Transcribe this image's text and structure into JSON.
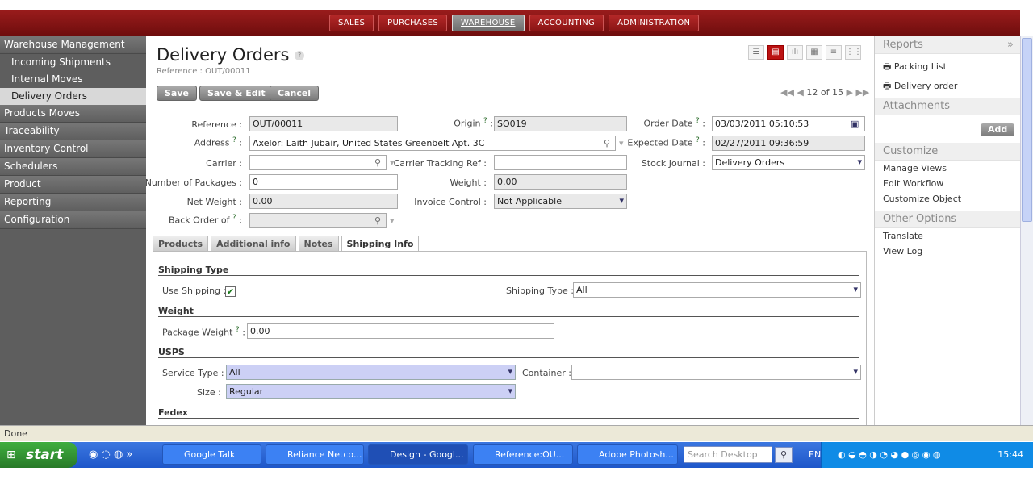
{
  "top_menu": [
    "SALES",
    "PURCHASES",
    "WAREHOUSE",
    "ACCOUNTING",
    "ADMINISTRATION"
  ],
  "sidebar": {
    "sections": [
      {
        "label": "Warehouse Management",
        "items": [
          "Incoming Shipments",
          "Internal Moves",
          "Delivery Orders"
        ]
      },
      {
        "label": "Products Moves",
        "items": []
      },
      {
        "label": "Traceability",
        "items": []
      },
      {
        "label": "Inventory Control",
        "items": []
      },
      {
        "label": "Schedulers",
        "items": []
      },
      {
        "label": "Product",
        "items": []
      },
      {
        "label": "Reporting",
        "items": []
      },
      {
        "label": "Configuration",
        "items": []
      }
    ]
  },
  "page": {
    "title": "Delivery Orders",
    "title_help": "?",
    "reference": "Reference : OUT/00011",
    "buttons": {
      "save": "Save",
      "save_edit": "Save & Edit",
      "cancel": "Cancel"
    },
    "pager": "12 of 15"
  },
  "form": {
    "reference_label": "Reference :",
    "reference": "OUT/00011",
    "origin_label": "Origin",
    "origin": "SO019",
    "order_date_label": "Order Date",
    "order_date": "03/03/2011 05:10:53",
    "address_label": "Address",
    "address": "Axelor: Laith Jubair, United States Greenbelt Apt. 3C",
    "expected_date_label": "Expected Date",
    "expected_date": "02/27/2011 09:36:59",
    "carrier_label": "Carrier :",
    "carrier": "",
    "tracking_label": "Carrier Tracking Ref :",
    "tracking": "",
    "journal_label": "Stock Journal :",
    "journal": "Delivery Orders",
    "packages_label": "Number of Packages :",
    "packages": "0",
    "weight_label": "Weight :",
    "weight": "0.00",
    "net_weight_label": "Net Weight :",
    "net_weight": "0.00",
    "invoice_label": "Invoice Control :",
    "invoice": "Not Applicable",
    "backorder_label": "Back Order of",
    "backorder": ""
  },
  "tabs": [
    "Products",
    "Additional info",
    "Notes",
    "Shipping Info"
  ],
  "shipping": {
    "section_type": "Shipping Type",
    "use_shipping_label": "Use Shipping :",
    "use_shipping": "✔",
    "shipping_type_label": "Shipping Type :",
    "shipping_type": "All",
    "section_weight": "Weight",
    "package_weight_label": "Package Weight",
    "package_weight": "0.00",
    "section_usps": "USPS",
    "service_type_label": "Service Type :",
    "service_type": "All",
    "container_label": "Container :",
    "container": "",
    "size_label": "Size :",
    "size": "Regular",
    "section_fedex": "Fedex"
  },
  "right_panel": {
    "reports_label": "Reports",
    "reports": [
      "Packing List",
      "Delivery order"
    ],
    "attachments_label": "Attachments",
    "add_label": "Add",
    "customize_label": "Customize",
    "customize": [
      "Manage Views",
      "Edit Workflow",
      "Customize Object"
    ],
    "other_label": "Other Options",
    "other": [
      "Translate",
      "View Log"
    ]
  },
  "status": "Done",
  "taskbar": {
    "start": "start",
    "tasks": [
      "Google Talk",
      "Reliance Netco...",
      "Design - Googl...",
      "Reference:OU...",
      "Adobe Photosh..."
    ],
    "search_placeholder": "Search Desktop",
    "lang": "EN",
    "time": "15:44"
  }
}
